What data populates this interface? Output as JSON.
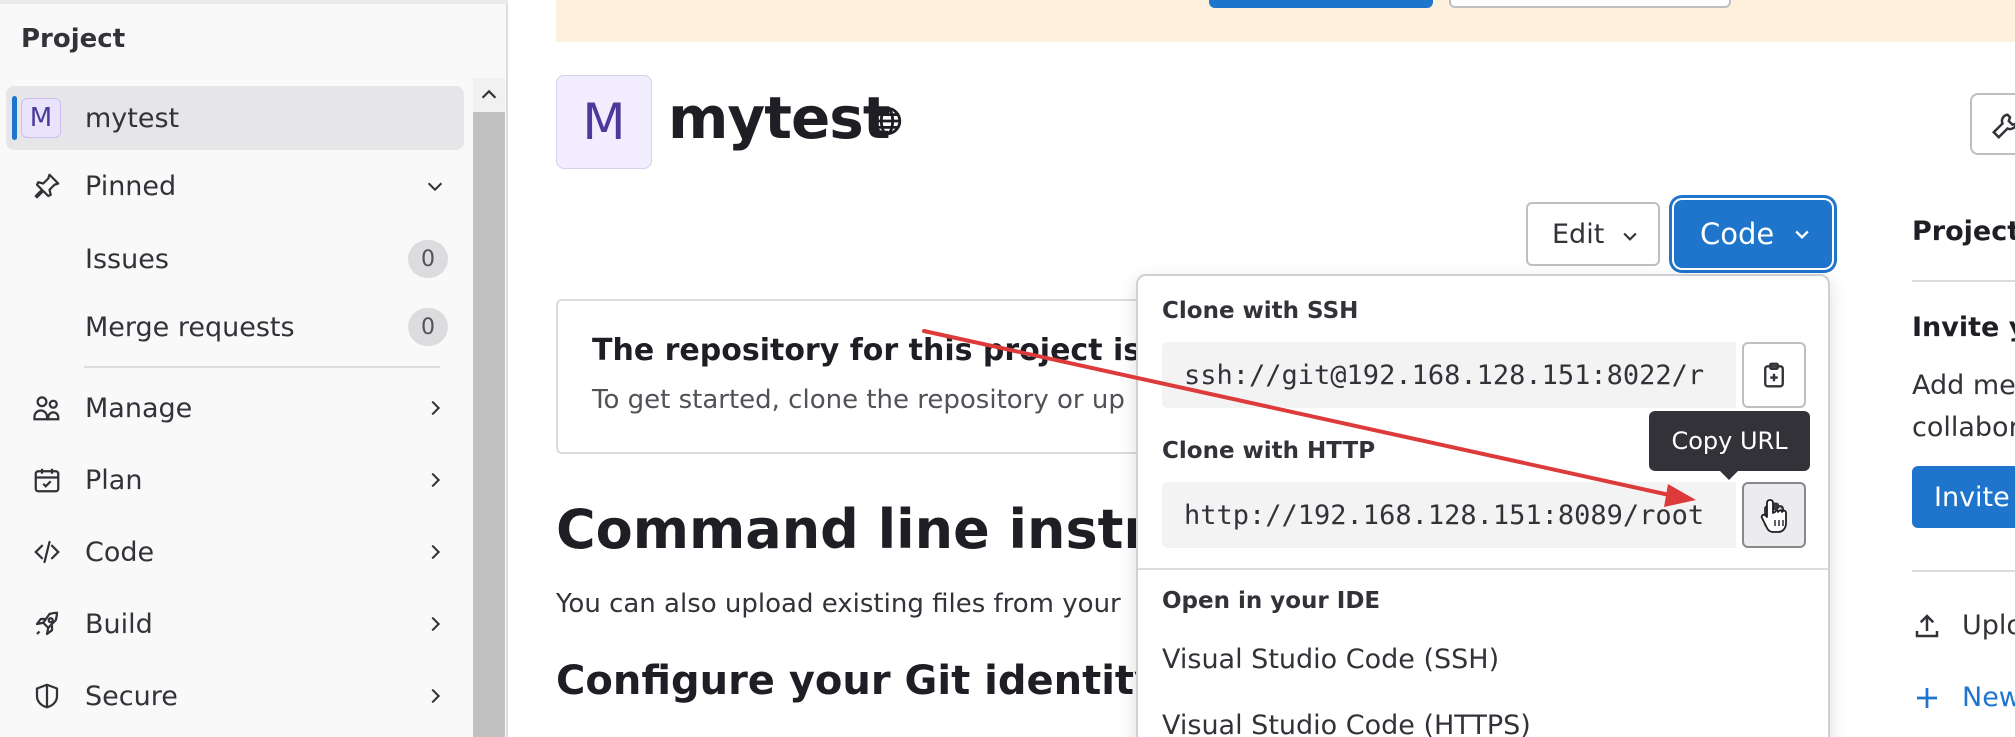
{
  "sidebar": {
    "heading": "Project",
    "project": {
      "avatar_letter": "M",
      "name": "mytest"
    },
    "pinned": {
      "label": "Pinned"
    },
    "pinned_items": [
      {
        "label": "Issues",
        "count": "0"
      },
      {
        "label": "Merge requests",
        "count": "0"
      }
    ],
    "nav": [
      {
        "label": "Manage",
        "icon": "users-icon"
      },
      {
        "label": "Plan",
        "icon": "calendar-icon"
      },
      {
        "label": "Code",
        "icon": "code-icon"
      },
      {
        "label": "Build",
        "icon": "rocket-icon"
      },
      {
        "label": "Secure",
        "icon": "shield-icon"
      }
    ]
  },
  "project_header": {
    "avatar_letter": "M",
    "title": "mytest",
    "visibility_icon": "globe-icon"
  },
  "actions": {
    "edit_label": "Edit",
    "code_label": "Code"
  },
  "empty_repo": {
    "title": "The repository for this project is em",
    "subtitle": "To get started, clone the repository or up"
  },
  "command_line": {
    "heading": "Command line instruct",
    "subtitle": "You can also upload existing files from your",
    "git_heading": "Configure your Git identity"
  },
  "right_column": {
    "title": "Project",
    "invite_title": "Invite yo",
    "text_line1": "Add me",
    "text_line2": "collabor",
    "invite_button": "Invite",
    "upload_label": "Uplo",
    "new_label": "New"
  },
  "clone_dropdown": {
    "ssh_title": "Clone with SSH",
    "ssh_url": "ssh://git@192.168.128.151:8022/r",
    "http_title": "Clone with HTTP",
    "http_url": "http://192.168.128.151:8089/root",
    "ide_title": "Open in your IDE",
    "ide_items": [
      "Visual Studio Code (SSH)",
      "Visual Studio Code (HTTPS)"
    ]
  },
  "tooltip": {
    "text": "Copy URL"
  },
  "colors": {
    "accent_blue": "#1f75cb",
    "annotation_red": "#dd3b3b",
    "banner_bg": "#fdf1dd",
    "sidebar_bg": "#f9f9fa"
  }
}
